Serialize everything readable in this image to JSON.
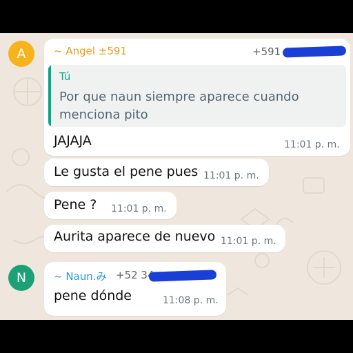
{
  "colors": {
    "chat_bg": "#efe7dd",
    "avatar_a": "#f6b31b",
    "avatar_n": "#1aa276",
    "angel_name": "#e79b1a",
    "naun_name": "#1e9bd8",
    "quote_accent": "#06a884",
    "redaction": "#1a3fd6"
  },
  "messages": [
    {
      "avatar_letter": "A",
      "sender": "~ Angel ±591",
      "phone": "+591",
      "quote": {
        "author": "Tú",
        "text": "Por que naun siempre aparece cuando menciona pito"
      },
      "text": "JAJAJA",
      "time": "11:01 p. m."
    },
    {
      "text": "Le gusta el pene pues",
      "time": "11:01 p. m."
    },
    {
      "text": "Pene ?",
      "time": "11:01 p. m."
    },
    {
      "text": "Aurita aparece de nuevo",
      "time": "11:01 p. m."
    },
    {
      "avatar_letter": "N",
      "sender": "~ Naun.み",
      "phone": "+52 34",
      "text": "pene dónde",
      "time": "11:08 p. m."
    }
  ]
}
